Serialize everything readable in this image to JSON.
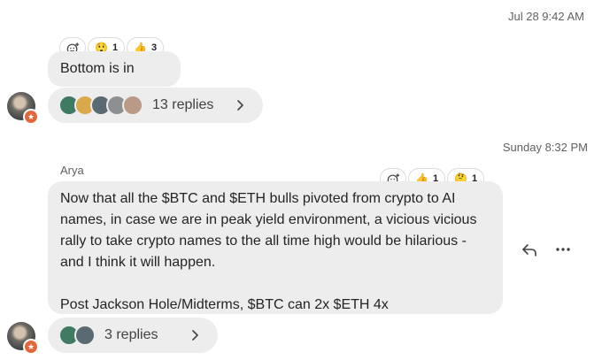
{
  "msg1": {
    "timestamp": "Jul 28 9:42 AM",
    "text": "Bottom is in",
    "reactions": [
      {
        "icon": "astonished-emoji",
        "glyph": "😲",
        "count": "1"
      },
      {
        "icon": "thumbs-up-emoji",
        "glyph": "👍",
        "count": "3"
      }
    ],
    "replies": "13 replies",
    "reply_avatar_colors": [
      "#3f7a63",
      "#d9a94a",
      "#5a6a73",
      "#8d8f90",
      "#b99a86"
    ]
  },
  "msg2": {
    "timestamp": "Sunday 8:32 PM",
    "sender": "Arya",
    "lines": [
      "Now that all the $BTC and $ETH bulls pivoted from crypto to AI",
      "names, in case we are in peak yield environment, a vicious vicious",
      "rally to take crypto names to the all time high would be hilarious -",
      "and I think it will happen.",
      "Post Jackson Hole/Midterms, $BTC can 2x $ETH 4x"
    ],
    "reactions": [
      {
        "icon": "thumbs-up-emoji",
        "glyph": "👍",
        "count": "1"
      },
      {
        "icon": "thinking-emoji",
        "glyph": "🤔",
        "count": "1"
      }
    ],
    "replies": "3 replies",
    "reply_avatar_colors": [
      "#3f7a63",
      "#5a6a73"
    ]
  },
  "icons": {
    "add_reaction": "add-reaction-icon",
    "chevron": "chevron-right-icon",
    "reply": "reply-arrow-icon",
    "more": "more-options-icon",
    "badge": "star-badge-icon",
    "badge_glyph": "★"
  },
  "colors": {
    "bubble": "#ededed",
    "badge": "#e2683c"
  }
}
